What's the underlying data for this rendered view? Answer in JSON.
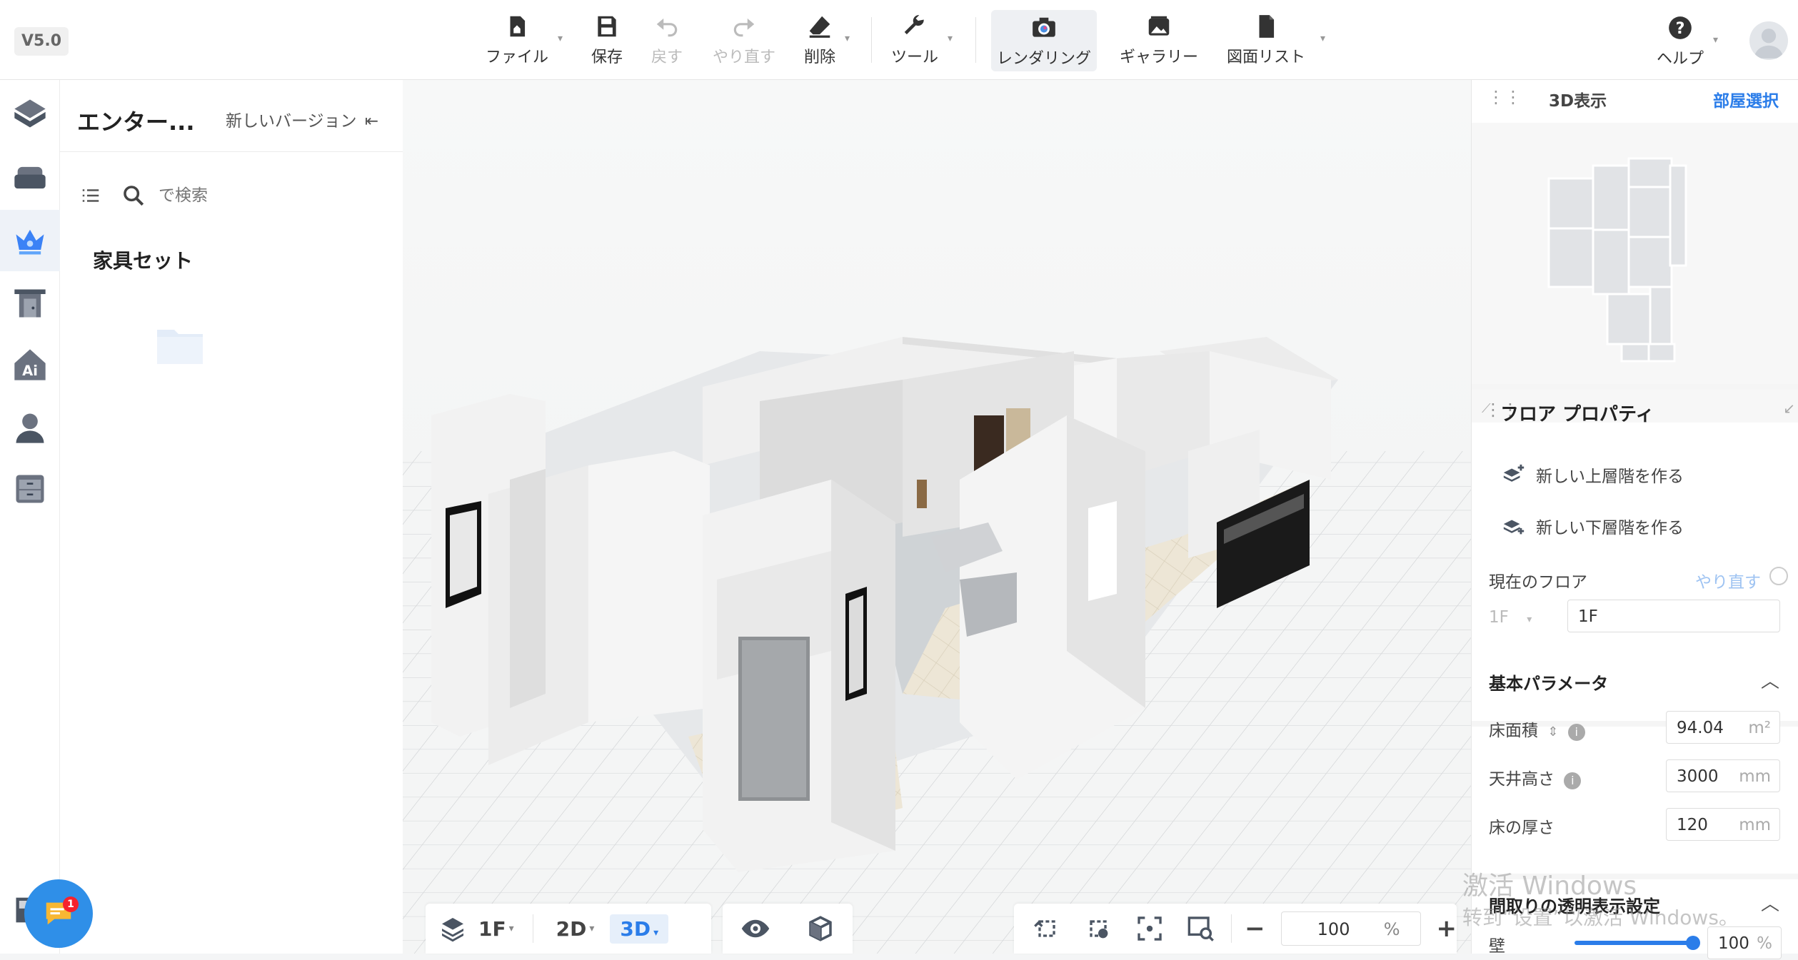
{
  "version": "V5.0",
  "toolbar": {
    "file": "ファイル",
    "save": "保存",
    "undo": "戻す",
    "redo": "やり直す",
    "delete": "削除",
    "tools": "ツール",
    "rendering": "レンダリング",
    "gallery": "ギャラリー",
    "drawing_list": "図面リスト",
    "help": "ヘルプ"
  },
  "left_panel": {
    "title": "エンター...",
    "new_version": "新しいバージョン",
    "search_placeholder": "で検索",
    "section": "家具セット"
  },
  "right_panel": {
    "view_title": "3D表示",
    "room_select": "部屋選択",
    "floor_props_title": "フロア プロパティ",
    "new_upper": "新しい上層階を作る",
    "new_lower": "新しい下層階を作る",
    "current_floor_label": "現在のフロア",
    "redo_link": "やり直す",
    "floor_select": "1F",
    "floor_name": "1F",
    "basic_params": "基本パラメータ",
    "floor_area_label": "床面積",
    "floor_area_value": "94.04",
    "floor_area_unit": "m²",
    "ceiling_label": "天井高さ",
    "ceiling_value": "3000",
    "ceiling_unit": "mm",
    "floor_thick_label": "床の厚さ",
    "floor_thick_value": "120",
    "floor_thick_unit": "mm",
    "transparency_title": "間取りの透明表示設定",
    "wall_label": "壁",
    "wall_value": "100",
    "wall_unit": "%"
  },
  "bottom_bar": {
    "floor": "1F",
    "mode_2d": "2D",
    "mode_3d": "3D",
    "zoom_value": "100",
    "zoom_unit": "%"
  },
  "chat_badge": "1",
  "watermark": {
    "line1": "激活 Windows",
    "line2": "转到“设置”以激活 Windows。"
  },
  "colors": {
    "accent": "#2b7de9",
    "chat_button": "#2f8fe8",
    "badge": "#f5222d"
  }
}
